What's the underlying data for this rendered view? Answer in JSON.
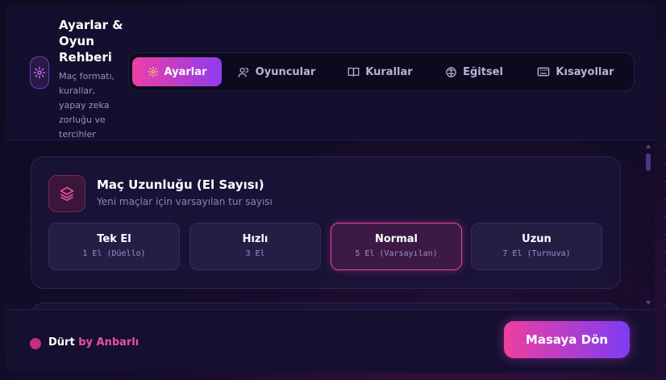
{
  "header": {
    "title": "Ayarlar & Oyun Rehberi",
    "subtitle": "Maç formatı, kurallar, yapay zeka zorluğu ve tercihler"
  },
  "tabs": [
    {
      "label": "Ayarlar",
      "icon": "gear-icon",
      "active": true
    },
    {
      "label": "Oyuncular",
      "icon": "users-icon",
      "active": false
    },
    {
      "label": "Kurallar",
      "icon": "book-icon",
      "active": false
    },
    {
      "label": "Eğitsel",
      "icon": "brain-icon",
      "active": false
    },
    {
      "label": "Kısayollar",
      "icon": "keyboard-icon",
      "active": false
    }
  ],
  "match_length": {
    "title": "Maç Uzunluğu (El Sayısı)",
    "subtitle": "Yeni maçlar için varsayılan tur sayısı",
    "options": [
      {
        "name": "Tek El",
        "value": "1 El (Düello)"
      },
      {
        "name": "Hızlı",
        "value": "3 El"
      },
      {
        "name": "Normal",
        "value": "5 El (Varsayılan)"
      },
      {
        "name": "Uzun",
        "value": "7 El (Turnuva)"
      }
    ],
    "selected": "Normal"
  },
  "footer": {
    "brand_name": "Dürt",
    "brand_by": "by Anbarlı",
    "return_button": "Masaya Dön"
  },
  "colors": {
    "accent_pink": "#ec3fa4",
    "accent_purple": "#8f3cf0",
    "background": "#0f0b22"
  }
}
